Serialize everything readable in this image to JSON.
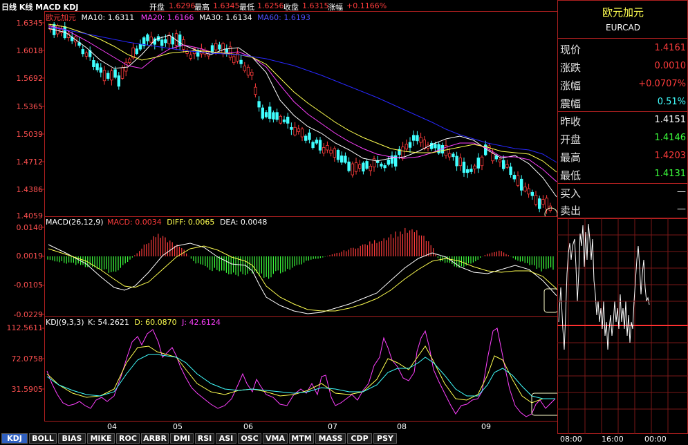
{
  "header": {
    "title": "日线 K线 MACD KDJ",
    "fields": [
      {
        "label": "开盘",
        "value": "1.6296"
      },
      {
        "label": "最高",
        "value": "1.6345"
      },
      {
        "label": "最低",
        "value": "1.6256"
      },
      {
        "label": "收盘",
        "value": "1.6315"
      },
      {
        "label": "涨幅",
        "value": "+0.1166%"
      }
    ]
  },
  "main_chart": {
    "name": "欧元加元",
    "ma": [
      {
        "label": "MA10: 1.6311",
        "color": "#ffffff"
      },
      {
        "label": "MA20: 1.6166",
        "color": "#ff40ff"
      },
      {
        "label": "MA30: 1.6134",
        "color": "#ffffff"
      },
      {
        "label": "MA60: 1.6193",
        "color": "#2020ff"
      }
    ],
    "y_ticks": [
      "1.6345",
      "1.6018",
      "1.5692",
      "1.5365",
      "1.5039",
      "1.4712",
      "1.4386",
      "1.4059"
    ]
  },
  "macd_panel": {
    "title": "MACD(26,12,9)",
    "macd": "MACD: 0.0034",
    "diff": "DIFF: 0.0065",
    "dea": "DEA: 0.0048",
    "y_ticks": [
      "0.0140",
      "0.0019",
      "-0.0105",
      "-0.0229"
    ]
  },
  "kdj_panel": {
    "title": "KDJ(9,3,3)",
    "k": "K: 54.2621",
    "d": "D: 60.0870",
    "j": "J: 42.6124",
    "y_ticks": [
      "112.5611",
      "72.0758",
      "31.5905"
    ]
  },
  "x_ticks": [
    "04",
    "05",
    "06",
    "07",
    "08",
    "09"
  ],
  "quote": {
    "name": "欧元加元",
    "code": "EURCAD",
    "rows": [
      {
        "label": "现价",
        "value": "1.4161",
        "color": "#ff3c3c"
      },
      {
        "label": "涨跌",
        "value": "0.0010",
        "color": "#ff3c3c"
      },
      {
        "label": "涨幅",
        "value": "+0.0707%",
        "color": "#ff3c3c"
      },
      {
        "label": "震幅",
        "value": "0.51%",
        "color": "#40ffff"
      },
      {
        "label": "昨收",
        "value": "1.4151",
        "color": "#ffffff"
      },
      {
        "label": "开盘",
        "value": "1.4146",
        "color": "#3cff3c"
      },
      {
        "label": "最高",
        "value": "1.4203",
        "color": "#ff3c3c"
      },
      {
        "label": "最低",
        "value": "1.4131",
        "color": "#3cff3c"
      },
      {
        "label": "买入",
        "value": "—",
        "color": "#ffffff"
      },
      {
        "label": "卖出",
        "value": "—",
        "color": "#ffffff"
      }
    ],
    "time_ticks": [
      "08:00",
      "16:00",
      "00:00"
    ]
  },
  "tabs": [
    "KDJ",
    "BOLL",
    "BIAS",
    "MIKE",
    "ROC",
    "ARBR",
    "DMI",
    "RSI",
    "ASI",
    "OSC",
    "VMA",
    "MTM",
    "MASS",
    "CDP",
    "PSY"
  ],
  "active_tab": "KDJ"
}
